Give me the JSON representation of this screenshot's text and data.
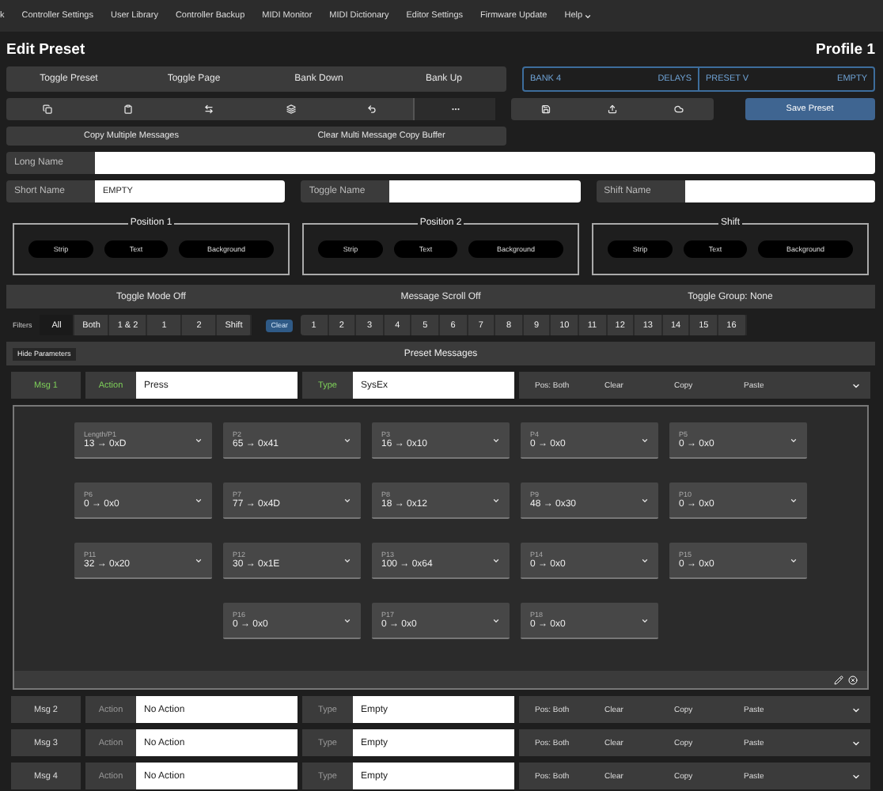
{
  "nav": [
    {
      "label": "k",
      "dropdown": false
    },
    {
      "label": "Controller Settings",
      "dropdown": false
    },
    {
      "label": "User Library",
      "dropdown": false
    },
    {
      "label": "Controller Backup",
      "dropdown": false
    },
    {
      "label": "MIDI Monitor",
      "dropdown": false
    },
    {
      "label": "MIDI Dictionary",
      "dropdown": false
    },
    {
      "label": "Editor Settings",
      "dropdown": false
    },
    {
      "label": "Firmware Update",
      "dropdown": false
    },
    {
      "label": "Help",
      "dropdown": true
    }
  ],
  "title": "Edit Preset",
  "profile": "Profile 1",
  "actions": [
    "Toggle Preset",
    "Toggle Page",
    "Bank Down",
    "Bank Up"
  ],
  "bank": {
    "bank": "BANK 4",
    "bank_name": "DELAYS",
    "preset": "PRESET V",
    "preset_name": "EMPTY"
  },
  "tools": [
    {
      "kind": "copy",
      "pressed": false
    },
    {
      "kind": "paste",
      "pressed": false
    },
    {
      "kind": "swap",
      "pressed": false
    },
    {
      "kind": "layers",
      "pressed": false
    },
    {
      "kind": "undo",
      "pressed": false
    },
    {
      "kind": "more",
      "pressed": true
    }
  ],
  "file_tools": [
    {
      "kind": "save"
    },
    {
      "kind": "upload"
    },
    {
      "kind": "cloud"
    }
  ],
  "save_button": "Save Preset",
  "copy_buttons": [
    "Copy Multiple Messages",
    "Clear Multi Message Copy Buffer"
  ],
  "long_name": {
    "label": "Long Name"
  },
  "names": [
    {
      "label": "Short Name",
      "value": "EMPTY"
    },
    {
      "label": "Toggle Name"
    },
    {
      "label": "Shift Name"
    }
  ],
  "positions": [
    {
      "title": "Position 1",
      "buttons": [
        "Strip",
        "Text",
        "Background"
      ]
    },
    {
      "title": "Position 2",
      "buttons": [
        "Strip",
        "Text",
        "Background"
      ]
    },
    {
      "title": "Shift",
      "buttons": [
        "Strip",
        "Text",
        "Background"
      ]
    }
  ],
  "modes": [
    "Toggle Mode Off",
    "Message Scroll Off",
    "Toggle Group: None"
  ],
  "filters": {
    "label": "Filters",
    "options": [
      {
        "label": "All",
        "selected": true
      },
      {
        "label": "Both",
        "selected": false
      },
      {
        "label": "1 & 2",
        "selected": false
      },
      {
        "label": "1",
        "selected": false
      },
      {
        "label": "2",
        "selected": false
      },
      {
        "label": "Shift",
        "selected": false
      }
    ],
    "clear": "Clear",
    "channels": [
      {
        "label": "1",
        "selected": false
      },
      {
        "label": "2",
        "selected": false
      },
      {
        "label": "3",
        "selected": false
      },
      {
        "label": "4",
        "selected": false
      },
      {
        "label": "5",
        "selected": false
      },
      {
        "label": "6",
        "selected": false
      },
      {
        "label": "7",
        "selected": false
      },
      {
        "label": "8",
        "selected": false
      },
      {
        "label": "9",
        "selected": false
      },
      {
        "label": "10",
        "selected": false
      },
      {
        "label": "11",
        "selected": false
      },
      {
        "label": "12",
        "selected": false
      },
      {
        "label": "13",
        "selected": false
      },
      {
        "label": "14",
        "selected": false
      },
      {
        "label": "15",
        "selected": false
      },
      {
        "label": "16",
        "selected": false
      }
    ]
  },
  "messages_header": {
    "hide_button": "Hide Parameters",
    "title": "Preset Messages"
  },
  "messages": [
    {
      "name": "Msg 1",
      "action_label": "Action",
      "action": "Press",
      "type_label": "Type",
      "type": "SysEx",
      "position": "Pos: Both",
      "clear": "Clear",
      "copy": "Copy",
      "paste": "Paste",
      "active": true,
      "params": [
        {
          "label": "Length/P1",
          "value": "13 → 0xD"
        },
        {
          "label": "P2",
          "value": "65 → 0x41"
        },
        {
          "label": "P3",
          "value": "16 → 0x10"
        },
        {
          "label": "P4",
          "value": "0 → 0x0"
        },
        {
          "label": "P5",
          "value": "0 → 0x0"
        },
        {
          "label": "P6",
          "value": "0 → 0x0"
        },
        {
          "label": "P7",
          "value": "77 → 0x4D"
        },
        {
          "label": "P8",
          "value": "18 → 0x12"
        },
        {
          "label": "P9",
          "value": "48 → 0x30"
        },
        {
          "label": "P10",
          "value": "0 → 0x0"
        },
        {
          "label": "P11",
          "value": "32 → 0x20"
        },
        {
          "label": "P12",
          "value": "30 → 0x1E"
        },
        {
          "label": "P13",
          "value": "100 → 0x64"
        },
        {
          "label": "P14",
          "value": "0 → 0x0"
        },
        {
          "label": "P15",
          "value": "0 → 0x0"
        },
        {
          "label": "P16",
          "value": "0 → 0x0"
        },
        {
          "label": "P17",
          "value": "0 → 0x0"
        },
        {
          "label": "P18",
          "value": "0 → 0x0"
        }
      ]
    },
    {
      "name": "Msg 2",
      "action_label": "Action",
      "action": "No Action",
      "type_label": "Type",
      "type": "Empty",
      "position": "Pos: Both",
      "clear": "Clear",
      "copy": "Copy",
      "paste": "Paste",
      "active": false
    },
    {
      "name": "Msg 3",
      "action_label": "Action",
      "action": "No Action",
      "type_label": "Type",
      "type": "Empty",
      "position": "Pos: Both",
      "clear": "Clear",
      "copy": "Copy",
      "paste": "Paste",
      "active": false
    },
    {
      "name": "Msg 4",
      "action_label": "Action",
      "action": "No Action",
      "type_label": "Type",
      "type": "Empty",
      "position": "Pos: Both",
      "clear": "Clear",
      "copy": "Copy",
      "paste": "Paste",
      "active": false
    }
  ]
}
